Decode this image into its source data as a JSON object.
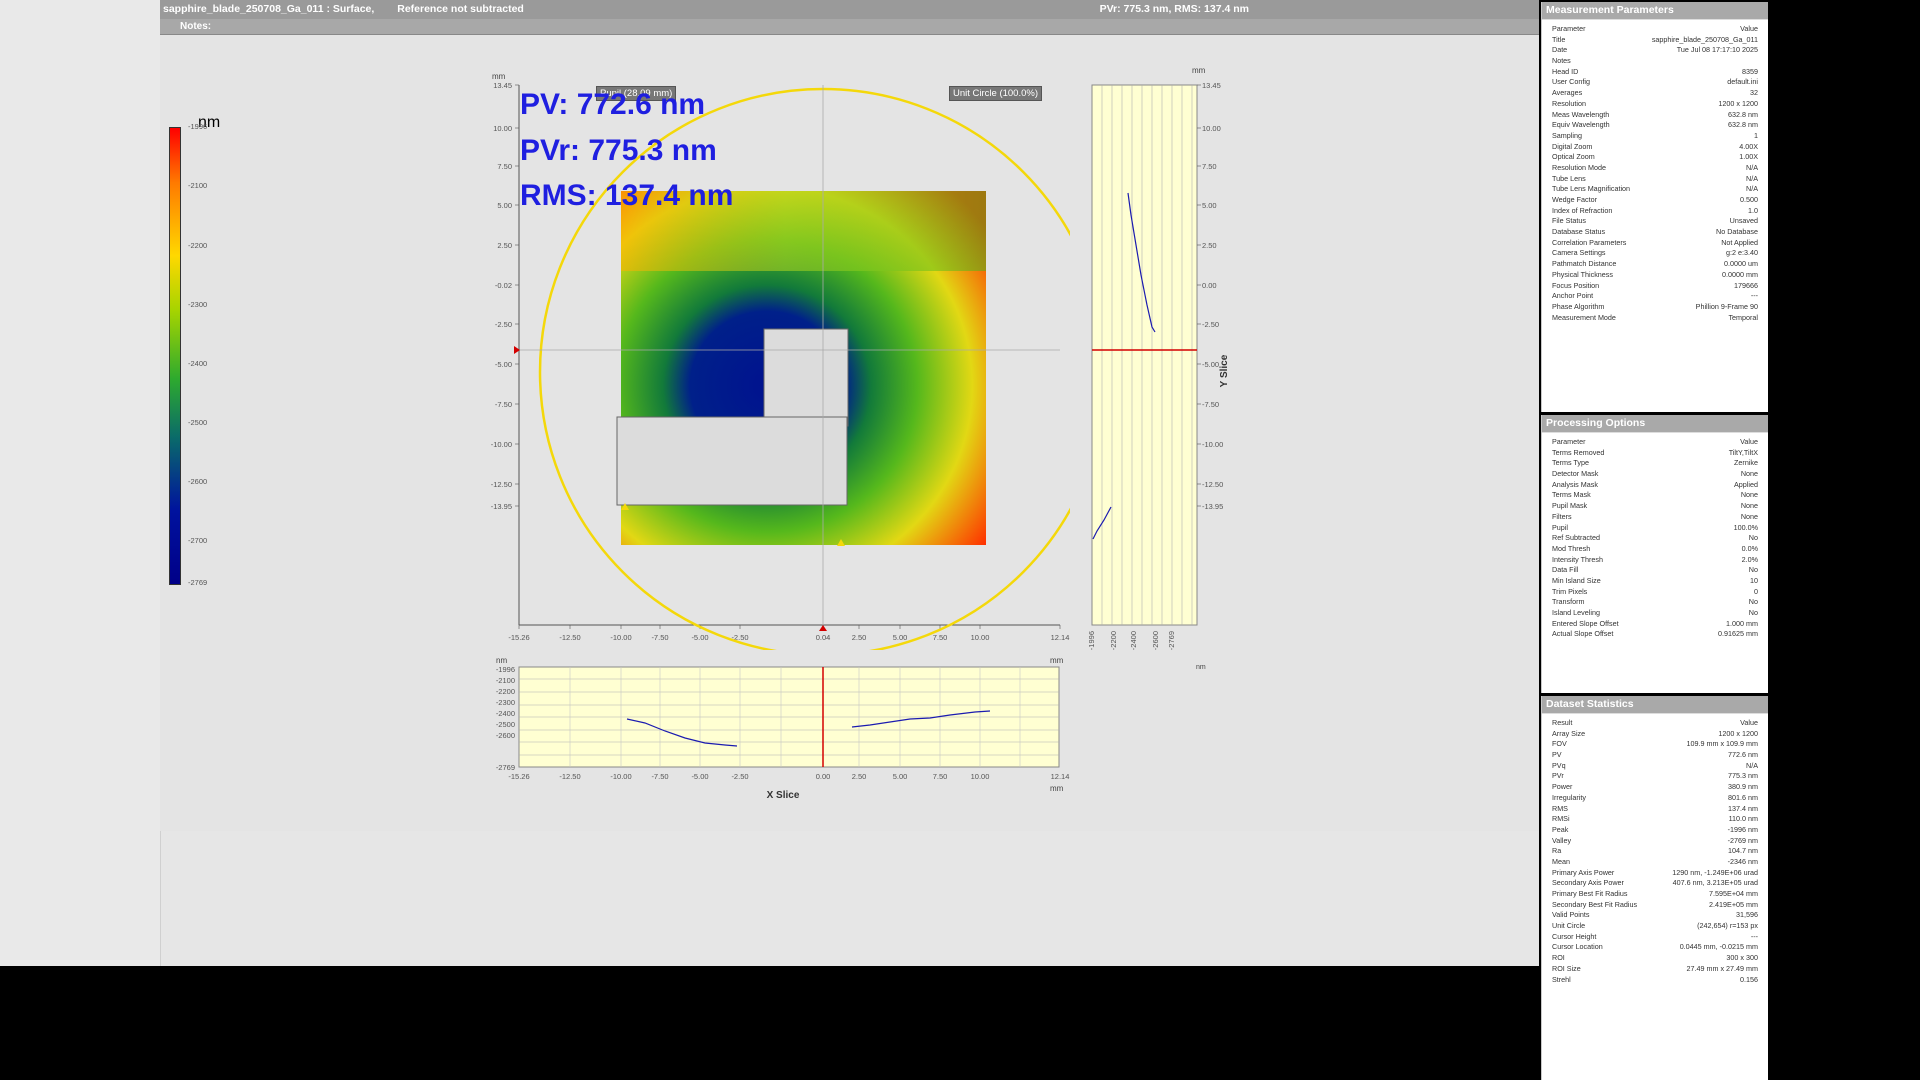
{
  "header": {
    "title": "sapphire_blade_250708_Ga_011 : Surface,",
    "reference": "Reference not subtracted",
    "readout": "PVr: 775.3 nm, RMS: 137.4 nm",
    "notes_label": "Notes:"
  },
  "metrics": {
    "pv": "PV: 772.6 nm",
    "pvr": "PVr: 775.3 nm",
    "rms": "RMS: 137.4 nm"
  },
  "overlays": {
    "pupil": "Pupil (28.09 mm)",
    "unit_circle": "Unit Circle (100.0%)"
  },
  "colorbar": {
    "unit": "nm",
    "ticks": [
      "-1996",
      "-2100",
      "-2200",
      "-2300",
      "-2400",
      "-2500",
      "-2600",
      "-2700",
      "-2769"
    ]
  },
  "surface_plot": {
    "unit": "mm",
    "y_ticks": [
      "13.45",
      "10.00",
      "7.50",
      "5.00",
      "2.50",
      "-0.02",
      "-2.50",
      "-5.00",
      "-7.50",
      "-10.00",
      "-12.50",
      "-13.95"
    ],
    "x_ticks": [
      "-15.26",
      "-12.50",
      "-10.00",
      "-7.50",
      "-5.00",
      "-2.50",
      "0.04",
      "2.50",
      "5.00",
      "7.50",
      "10.00",
      "12.14"
    ]
  },
  "y_slice": {
    "title": "Y Slice",
    "unit_top": "mm",
    "unit_bottom": "nm",
    "y_ticks": [
      "13.45",
      "10.00",
      "7.50",
      "5.00",
      "2.50",
      "0.00",
      "-2.50",
      "-5.00",
      "-7.50",
      "-10.00",
      "-12.50",
      "-13.95"
    ],
    "x_ticks": [
      "-1996",
      "-2200",
      "-2400",
      "-2600",
      "-2769"
    ]
  },
  "x_slice": {
    "title": "X Slice",
    "unit_left": "nm",
    "unit_right_top": "mm",
    "unit_right_bottom": "mm",
    "y_ticks": [
      "-1996",
      "-2100",
      "-2200",
      "-2300",
      "-2400",
      "-2500",
      "-2600",
      "-2769"
    ],
    "x_ticks": [
      "-15.26",
      "-12.50",
      "-10.00",
      "-7.50",
      "-5.00",
      "-2.50",
      "0.00",
      "2.50",
      "5.00",
      "7.50",
      "10.00",
      "12.14"
    ]
  },
  "panels": {
    "measurement": {
      "title": "Measurement Parameters",
      "rows": [
        [
          "Parameter",
          "Value"
        ],
        [
          "Title",
          "sapphire_blade_250708_Ga_011"
        ],
        [
          "Date",
          "Tue Jul 08 17:17:10 2025"
        ],
        [
          "Notes",
          ""
        ],
        [
          "Head ID",
          "8359"
        ],
        [
          "User Config",
          "default.ini"
        ],
        [
          "Averages",
          "32"
        ],
        [
          "Resolution",
          "1200 x 1200"
        ],
        [
          "Meas Wavelength",
          "632.8 nm"
        ],
        [
          "Equiv Wavelength",
          "632.8 nm"
        ],
        [
          "Sampling",
          "1"
        ],
        [
          "Digital Zoom",
          "4.00X"
        ],
        [
          "Optical Zoom",
          "1.00X"
        ],
        [
          "Resolution Mode",
          "N/A"
        ],
        [
          "Tube Lens",
          "N/A"
        ],
        [
          "Tube Lens Magnification",
          "N/A"
        ],
        [
          "Wedge Factor",
          "0.500"
        ],
        [
          "Index of Refraction",
          "1.0"
        ],
        [
          "File Status",
          "Unsaved"
        ],
        [
          "Database Status",
          "No Database"
        ],
        [
          "Correlation Parameters",
          "Not Applied"
        ],
        [
          "Camera Settings",
          "g:2 e:3.40"
        ],
        [
          "Pathmatch Distance",
          "0.0000 um"
        ],
        [
          "Physical Thickness",
          "0.0000 mm"
        ],
        [
          "Focus Position",
          "179666"
        ],
        [
          "Anchor Point",
          "---"
        ],
        [
          "Phase Algorithm",
          "Phillion 9-Frame 90"
        ],
        [
          "Measurement Mode",
          "Temporal"
        ]
      ]
    },
    "processing": {
      "title": "Processing Options",
      "rows": [
        [
          "Parameter",
          "Value"
        ],
        [
          "Terms Removed",
          "TiltY,TiltX"
        ],
        [
          "Terms Type",
          "Zernike"
        ],
        [
          "Detector Mask",
          "None"
        ],
        [
          "Analysis Mask",
          "Applied"
        ],
        [
          "Terms Mask",
          "None"
        ],
        [
          "Pupil Mask",
          "None"
        ],
        [
          "Filters",
          "None"
        ],
        [
          "Pupil",
          "100.0%"
        ],
        [
          "Ref Subtracted",
          "No"
        ],
        [
          "Mod Thresh",
          "0.0%"
        ],
        [
          "Intensity Thresh",
          "2.0%"
        ],
        [
          "Data Fill",
          "No"
        ],
        [
          "Min Island Size",
          "10"
        ],
        [
          "Trim Pixels",
          "0"
        ],
        [
          "Transform",
          "No"
        ],
        [
          "Island Leveling",
          "No"
        ],
        [
          "Entered Slope Offset",
          "1.000 mm"
        ],
        [
          "Actual Slope Offset",
          "0.91625 mm"
        ]
      ]
    },
    "statistics": {
      "title": "Dataset Statistics",
      "rows": [
        [
          "Result",
          "Value"
        ],
        [
          "Array Size",
          "1200 x 1200"
        ],
        [
          "FOV",
          "109.9 mm x 109.9 mm"
        ],
        [
          "PV",
          "772.6 nm"
        ],
        [
          "PVq",
          "N/A"
        ],
        [
          "PVr",
          "775.3 nm"
        ],
        [
          "Power",
          "380.9 nm"
        ],
        [
          "Irregularity",
          "801.6 nm"
        ],
        [
          "RMS",
          "137.4 nm"
        ],
        [
          "RMSi",
          "110.0 nm"
        ],
        [
          "Peak",
          "-1996 nm"
        ],
        [
          "Valley",
          "-2769 nm"
        ],
        [
          "Ra",
          "104.7 nm"
        ],
        [
          "Mean",
          "-2346 nm"
        ],
        [
          "Primary Axis Power",
          "1290 nm, -1.249E+06 urad"
        ],
        [
          "Secondary Axis Power",
          "407.6 nm, 3.213E+05 urad"
        ],
        [
          "Primary Best Fit Radius",
          "7.595E+04 mm"
        ],
        [
          "Secondary Best Fit Radius",
          "2.419E+05 mm"
        ],
        [
          "Valid Points",
          "31,596"
        ],
        [
          "Unit Circle",
          "(242,654) r=153 px"
        ],
        [
          "Cursor Height",
          "---"
        ],
        [
          "Cursor Location",
          "0.0445 mm, -0.0215 mm"
        ],
        [
          "ROI",
          "300 x 300"
        ],
        [
          "ROI Size",
          "27.49 mm x 27.49 mm"
        ],
        [
          "Strehl",
          "0.156"
        ]
      ]
    }
  },
  "colors": {
    "metric_text": "#1f1fe0",
    "slice_bg": "#ffffd2",
    "unit_circle": "#f4d80a",
    "cursor": "#d40000"
  }
}
